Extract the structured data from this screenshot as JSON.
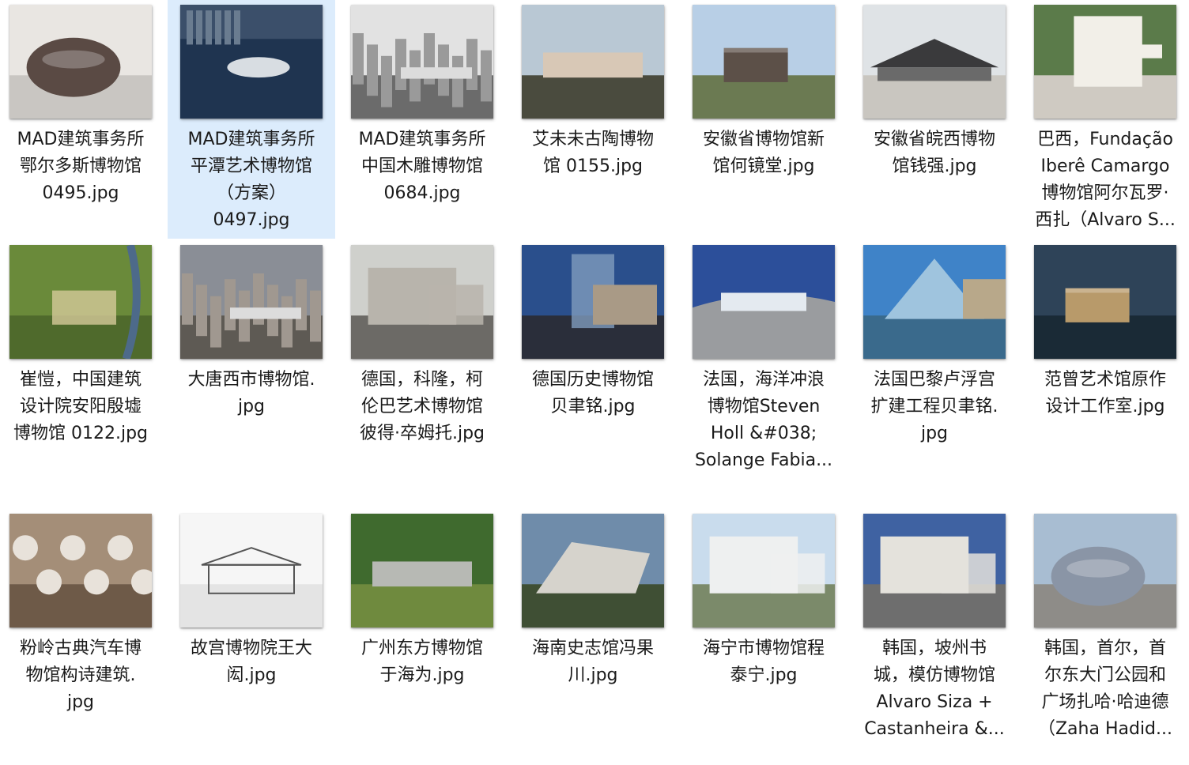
{
  "files": [
    {
      "name": "MAD建筑事务所\n鄂尔多斯博物馆\n0495.jpg",
      "selected": false,
      "thumb": {
        "sky": "#e9e6e2",
        "ground": "#c9c6c2",
        "bld": "#5a4a44",
        "shape": "blob"
      }
    },
    {
      "name": "MAD建筑事务所\n平潭艺术博物馆\n（方案）\n0497.jpg",
      "selected": true,
      "thumb": {
        "sky": "#3b4f6a",
        "ground": "#1e3046",
        "bld": "#d8dde2",
        "shape": "island"
      }
    },
    {
      "name": "MAD建筑事务所\n中国木雕博物馆\n0684.jpg",
      "selected": false,
      "thumb": {
        "sky": "#e2e2e2",
        "ground": "#6b6b6b",
        "bld": "#9a9a9a",
        "shape": "city"
      }
    },
    {
      "name": "艾未未古陶博物\n馆 0155.jpg",
      "selected": false,
      "thumb": {
        "sky": "#b9c8d4",
        "ground": "#4a4b3e",
        "bld": "#d8c8b6",
        "shape": "long"
      }
    },
    {
      "name": "安徽省博物馆新\n馆何镜堂.jpg",
      "selected": false,
      "thumb": {
        "sky": "#b8cfe6",
        "ground": "#6b7a52",
        "bld": "#5c5048",
        "shape": "cube"
      }
    },
    {
      "name": "安徽省皖西博物\n馆钱强.jpg",
      "selected": false,
      "thumb": {
        "sky": "#dfe3e6",
        "ground": "#c9c6c0",
        "bld": "#3a3a3c",
        "shape": "roof"
      }
    },
    {
      "name": "巴西，Fundação\nIberê Camargo\n博物馆阿尔瓦罗·\n西扎（Alvaro S...",
      "selected": false,
      "thumb": {
        "sky": "#5b7b4a",
        "ground": "#cfcac2",
        "bld": "#f2efe8",
        "shape": "tower"
      }
    },
    {
      "name": "崔愷，中国建筑\n设计院安阳殷墟\n博物馆 0122.jpg",
      "selected": false,
      "thumb": {
        "sky": "#6a8a3a",
        "ground": "#4f6a2c",
        "bld": "#d4c99a",
        "shape": "aerial"
      }
    },
    {
      "name": "大唐西市博物馆.\njpg",
      "selected": false,
      "thumb": {
        "sky": "#8a8e96",
        "ground": "#5e5a54",
        "bld": "#a09890",
        "shape": "city"
      }
    },
    {
      "name": "德国，科隆，柯\n伦巴艺术博物馆\n彼得·卒姆托.jpg",
      "selected": false,
      "thumb": {
        "sky": "#cfd0cc",
        "ground": "#6c6a66",
        "bld": "#b8b4ac",
        "shape": "block"
      }
    },
    {
      "name": "德国历史博物馆\n贝聿铭.jpg",
      "selected": false,
      "thumb": {
        "sky": "#2a4f8c",
        "ground": "#2a2e3a",
        "bld": "#a99a86",
        "shape": "drum"
      }
    },
    {
      "name": "法国，海洋冲浪\n博物馆Steven\nHoll &#038;\nSolange Fabia...",
      "selected": false,
      "thumb": {
        "sky": "#2c4f9a",
        "ground": "#8c8f94",
        "bld": "#e4eaf0",
        "shape": "wave"
      }
    },
    {
      "name": "法国巴黎卢浮宫\n扩建工程贝聿铭.\njpg",
      "selected": false,
      "thumb": {
        "sky": "#3f83c8",
        "ground": "#3a6a8c",
        "bld": "#9fc4de",
        "shape": "pyramid"
      }
    },
    {
      "name": "范曾艺术馆原作\n设计工作室.jpg",
      "selected": false,
      "thumb": {
        "sky": "#2e4358",
        "ground": "#1a2a36",
        "bld": "#b89a6a",
        "shape": "cube"
      }
    },
    {
      "name": "粉岭古典汽车博\n物馆构诗建筑.\njpg",
      "selected": false,
      "thumb": {
        "sky": "#a48e78",
        "ground": "#6e5a48",
        "bld": "#e8e2da",
        "shape": "holes"
      }
    },
    {
      "name": "故宫博物院王大\n闳.jpg",
      "selected": false,
      "thumb": {
        "sky": "#f6f6f6",
        "ground": "#e4e4e4",
        "bld": "#555555",
        "shape": "sketch"
      }
    },
    {
      "name": "广州东方博物馆\n于海为.jpg",
      "selected": false,
      "thumb": {
        "sky": "#3f6a2e",
        "ground": "#6f8a3e",
        "bld": "#b7b9b4",
        "shape": "long"
      }
    },
    {
      "name": "海南史志馆冯果\n川.jpg",
      "selected": false,
      "thumb": {
        "sky": "#6f8caa",
        "ground": "#3f4f34",
        "bld": "#d6d3cc",
        "shape": "wedge"
      }
    },
    {
      "name": "海宁市博物馆程\n泰宁.jpg",
      "selected": false,
      "thumb": {
        "sky": "#c9dced",
        "ground": "#7b8a6a",
        "bld": "#eef0f0",
        "shape": "block"
      }
    },
    {
      "name": "韩国，坡州书\n城，模仿博物馆\nAlvaro Siza +\nCastanheira &...",
      "selected": false,
      "thumb": {
        "sky": "#3f62a2",
        "ground": "#6e6e6e",
        "bld": "#e4e2dc",
        "shape": "block"
      }
    },
    {
      "name": "韩国，首尔，首\n尔东大门公园和\n广场扎哈·哈迪德\n（Zaha Hadid...",
      "selected": false,
      "thumb": {
        "sky": "#a8bdd2",
        "ground": "#8e8c88",
        "bld": "#8a95a6",
        "shape": "blob"
      }
    }
  ]
}
